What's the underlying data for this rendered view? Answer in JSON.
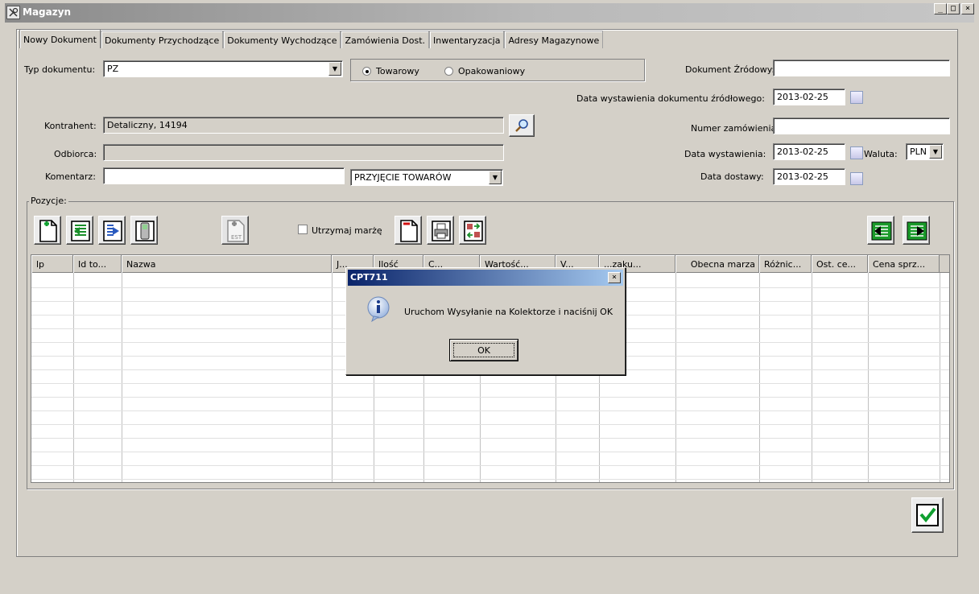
{
  "window": {
    "title": "Magazyn",
    "minimize": "_",
    "maximize": "□",
    "close": "×"
  },
  "tabs": [
    {
      "label": "Nowy Dokument"
    },
    {
      "label": "Dokumenty Przychodzące"
    },
    {
      "label": "Dokumenty Wychodzące"
    },
    {
      "label": "Zamówienia Dost."
    },
    {
      "label": "Inwentaryzacja"
    },
    {
      "label": "Adresy Magazynowe"
    }
  ],
  "form": {
    "typ_label": "Typ dokumentu:",
    "typ_value": "PZ",
    "radio_towarowy": "Towarowy",
    "radio_opakowaniowy": "Opakowaniowy",
    "kontrahent_label": "Kontrahent:",
    "kontrahent_value": "Detaliczny, 14194",
    "odbiorca_label": "Odbiorca:",
    "komentarz_label": "Komentarz:",
    "przyjecie_value": "PRZYJĘCIE TOWARÓW",
    "dok_zrodlowy_label": "Dokument Źródowy:",
    "data_zrodlowego_label": "Data wystawienia dokumentu źródłowego:",
    "data_zrodlowego_value": "2013-02-25",
    "numer_zam_label": "Numer zamówienia:",
    "data_wyst_label": "Data wystawienia:",
    "data_wyst_value": "2013-02-25",
    "waluta_label": "Waluta:",
    "waluta_value": "PLN",
    "data_dostawy_label": "Data dostawy:",
    "data_dostawy_value": "2013-02-25"
  },
  "pozycje": {
    "group_label": "Pozycje:",
    "utrzymaj_label": "Utrzymaj marżę",
    "est_label": "EST"
  },
  "grid": {
    "columns": [
      "lp",
      "Id to...",
      "Nazwa",
      "J...",
      "Ilość",
      "C...",
      "Wartość...",
      "V...",
      "...zaku...",
      "Obecna marza",
      "Różnic...",
      "Ost. ce...",
      "Cena sprz..."
    ]
  },
  "dialog": {
    "title": "CPT711",
    "close": "×",
    "message": "Uruchom Wysyłanie na Kolektorze i naciśnij OK",
    "ok": "OK"
  },
  "colors": {
    "accent_green": "#1a8f2a",
    "dialog_title": "#0a246a"
  }
}
